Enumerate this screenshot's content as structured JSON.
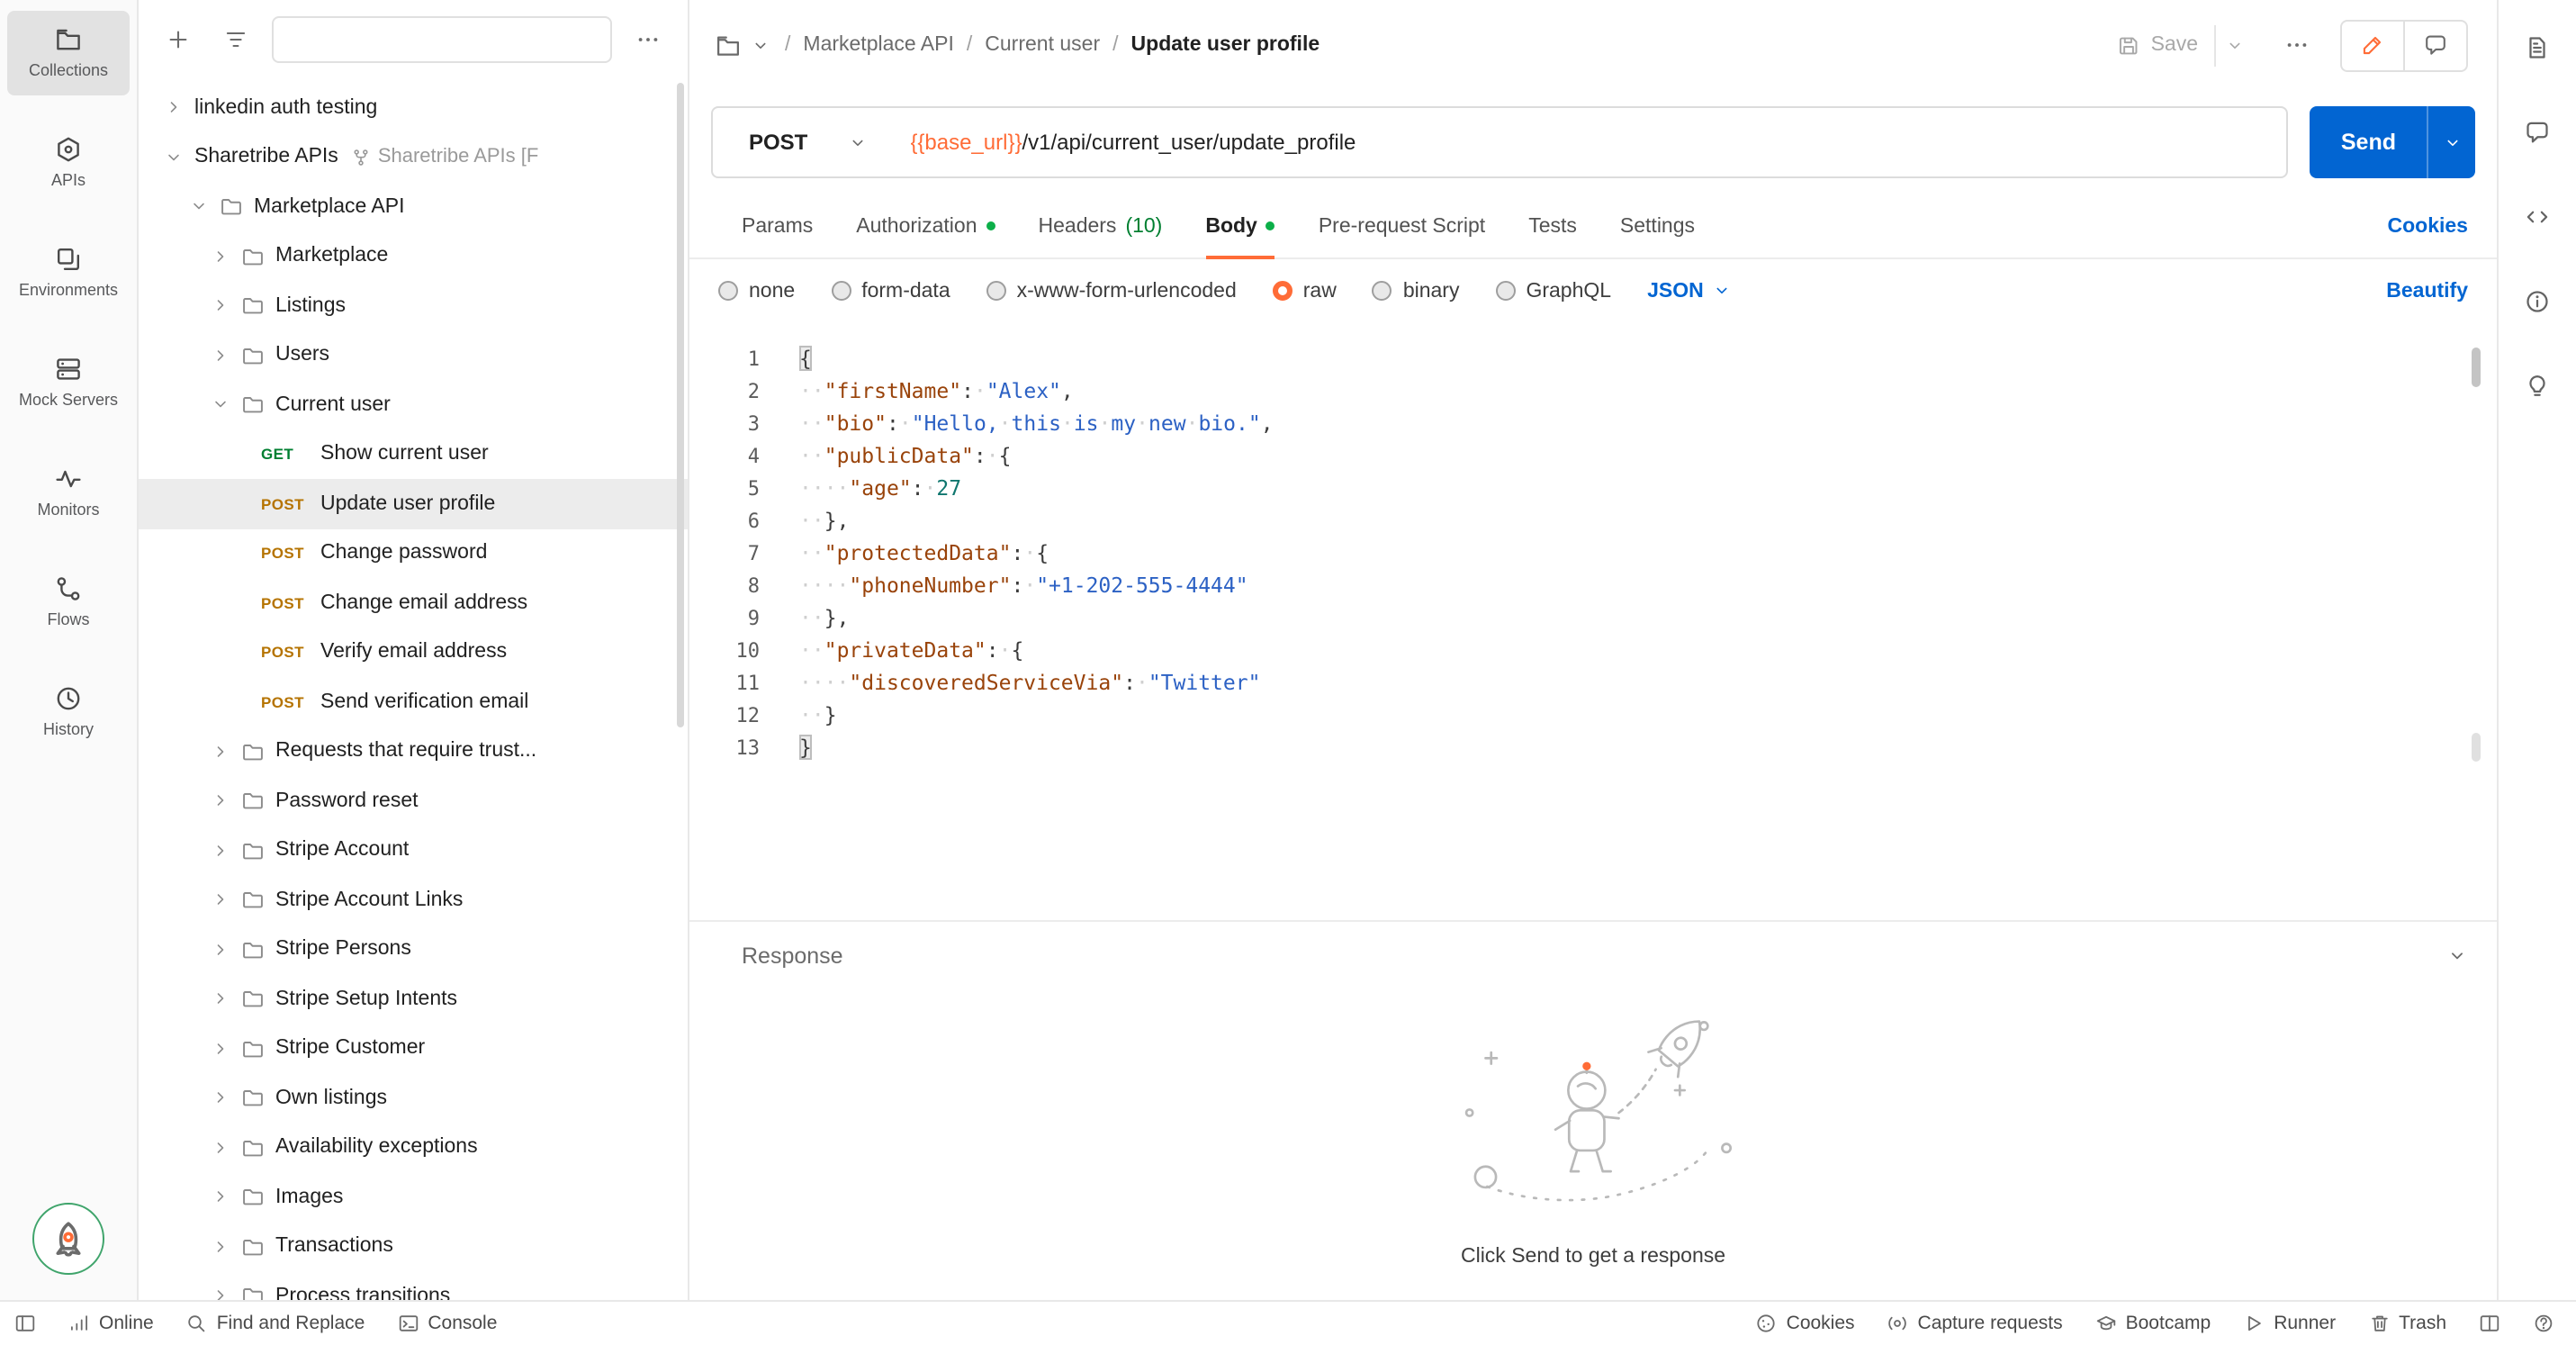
{
  "colors": {
    "accent": "#ff6c37",
    "primary_button": "#0265d2",
    "link": "#0265d2",
    "success_dot": "#0caf49",
    "method_get": "#007f31",
    "method_post": "#b57300"
  },
  "left_rail": {
    "items": [
      {
        "icon": "collections",
        "label": "Collections",
        "active": true
      },
      {
        "icon": "apis",
        "label": "APIs",
        "active": false
      },
      {
        "icon": "environments",
        "label": "Environments",
        "active": false
      },
      {
        "icon": "mock",
        "label": "Mock Servers",
        "active": false
      },
      {
        "icon": "monitors",
        "label": "Monitors",
        "active": false
      },
      {
        "icon": "flows",
        "label": "Flows",
        "active": false
      },
      {
        "icon": "history",
        "label": "History",
        "active": false
      }
    ]
  },
  "sidebar": {
    "search": {
      "value": "",
      "placeholder": ""
    },
    "tree": [
      {
        "kind": "collection",
        "chevron": "right",
        "label": "linkedin auth testing",
        "indent": 0
      },
      {
        "kind": "collection",
        "chevron": "down",
        "label": "Sharetribe APIs",
        "suffix": "Sharetribe APIs [F",
        "indent": 0
      },
      {
        "kind": "folder",
        "chevron": "down",
        "label": "Marketplace API",
        "indent": 1
      },
      {
        "kind": "folder",
        "chevron": "right",
        "label": "Marketplace",
        "indent": 2
      },
      {
        "kind": "folder",
        "chevron": "right",
        "label": "Listings",
        "indent": 2
      },
      {
        "kind": "folder",
        "chevron": "right",
        "label": "Users",
        "indent": 2
      },
      {
        "kind": "folder",
        "chevron": "down",
        "label": "Current user",
        "indent": 2
      },
      {
        "kind": "request",
        "method": "GET",
        "label": "Show current user",
        "indent": 3
      },
      {
        "kind": "request",
        "method": "POST",
        "label": "Update user profile",
        "indent": 3,
        "selected": true
      },
      {
        "kind": "request",
        "method": "POST",
        "label": "Change password",
        "indent": 3
      },
      {
        "kind": "request",
        "method": "POST",
        "label": "Change email address",
        "indent": 3
      },
      {
        "kind": "request",
        "method": "POST",
        "label": "Verify email address",
        "indent": 3
      },
      {
        "kind": "request",
        "method": "POST",
        "label": "Send verification email",
        "indent": 3
      },
      {
        "kind": "folder",
        "chevron": "right",
        "label": "Requests that require trust...",
        "indent": 2
      },
      {
        "kind": "folder",
        "chevron": "right",
        "label": "Password reset",
        "indent": 2
      },
      {
        "kind": "folder",
        "chevron": "right",
        "label": "Stripe Account",
        "indent": 2
      },
      {
        "kind": "folder",
        "chevron": "right",
        "label": "Stripe Account Links",
        "indent": 2
      },
      {
        "kind": "folder",
        "chevron": "right",
        "label": "Stripe Persons",
        "indent": 2
      },
      {
        "kind": "folder",
        "chevron": "right",
        "label": "Stripe Setup Intents",
        "indent": 2
      },
      {
        "kind": "folder",
        "chevron": "right",
        "label": "Stripe Customer",
        "indent": 2
      },
      {
        "kind": "folder",
        "chevron": "right",
        "label": "Own listings",
        "indent": 2
      },
      {
        "kind": "folder",
        "chevron": "right",
        "label": "Availability exceptions",
        "indent": 2
      },
      {
        "kind": "folder",
        "chevron": "right",
        "label": "Images",
        "indent": 2
      },
      {
        "kind": "folder",
        "chevron": "right",
        "label": "Transactions",
        "indent": 2
      },
      {
        "kind": "folder",
        "chevron": "right",
        "label": "Process transitions",
        "indent": 2
      }
    ]
  },
  "header": {
    "breadcrumb": [
      "Marketplace API",
      "Current user",
      "Update user profile"
    ],
    "save_label": "Save"
  },
  "request": {
    "method": "POST",
    "url_variable": "{{base_url}}",
    "url_path": "/v1/api/current_user/update_profile",
    "send_label": "Send"
  },
  "request_panel": {
    "tabs": [
      {
        "label": "Params"
      },
      {
        "label": "Authorization",
        "dot": true
      },
      {
        "label": "Headers",
        "count": "(10)"
      },
      {
        "label": "Body",
        "dot": true,
        "active": true
      },
      {
        "label": "Pre-request Script"
      },
      {
        "label": "Tests"
      },
      {
        "label": "Settings"
      }
    ],
    "cookies_label": "Cookies",
    "body_types": [
      {
        "label": "none"
      },
      {
        "label": "form-data"
      },
      {
        "label": "x-www-form-urlencoded"
      },
      {
        "label": "raw",
        "selected": true
      },
      {
        "label": "binary"
      },
      {
        "label": "GraphQL"
      }
    ],
    "language": "JSON",
    "beautify_label": "Beautify"
  },
  "editor": {
    "lines": [
      {
        "num": 1,
        "tokens": [
          {
            "t": "pun",
            "v": "{",
            "m": true
          }
        ]
      },
      {
        "num": 2,
        "tokens": [
          {
            "t": "ws",
            "n": 2
          },
          {
            "t": "key",
            "v": "\"firstName\""
          },
          {
            "t": "pun",
            "v": ":"
          },
          {
            "t": "ws",
            "n": 1
          },
          {
            "t": "str",
            "v": "\"Alex\""
          },
          {
            "t": "pun",
            "v": ","
          }
        ]
      },
      {
        "num": 3,
        "tokens": [
          {
            "t": "ws",
            "n": 2
          },
          {
            "t": "key",
            "v": "\"bio\""
          },
          {
            "t": "pun",
            "v": ":"
          },
          {
            "t": "ws",
            "n": 1
          },
          {
            "t": "str",
            "v": "\"Hello, this is my new bio.\""
          },
          {
            "t": "pun",
            "v": ","
          }
        ]
      },
      {
        "num": 4,
        "tokens": [
          {
            "t": "ws",
            "n": 2
          },
          {
            "t": "key",
            "v": "\"publicData\""
          },
          {
            "t": "pun",
            "v": ":"
          },
          {
            "t": "ws",
            "n": 1
          },
          {
            "t": "pun",
            "v": "{"
          }
        ]
      },
      {
        "num": 5,
        "tokens": [
          {
            "t": "ws",
            "n": 4
          },
          {
            "t": "key",
            "v": "\"age\""
          },
          {
            "t": "pun",
            "v": ":"
          },
          {
            "t": "ws",
            "n": 1
          },
          {
            "t": "num",
            "v": "27"
          }
        ]
      },
      {
        "num": 6,
        "tokens": [
          {
            "t": "ws",
            "n": 2
          },
          {
            "t": "pun",
            "v": "},"
          }
        ]
      },
      {
        "num": 7,
        "tokens": [
          {
            "t": "ws",
            "n": 2
          },
          {
            "t": "key",
            "v": "\"protectedData\""
          },
          {
            "t": "pun",
            "v": ":"
          },
          {
            "t": "ws",
            "n": 1
          },
          {
            "t": "pun",
            "v": "{"
          }
        ]
      },
      {
        "num": 8,
        "tokens": [
          {
            "t": "ws",
            "n": 4
          },
          {
            "t": "key",
            "v": "\"phoneNumber\""
          },
          {
            "t": "pun",
            "v": ":"
          },
          {
            "t": "ws",
            "n": 1
          },
          {
            "t": "str",
            "v": "\"+1-202-555-4444\""
          }
        ]
      },
      {
        "num": 9,
        "tokens": [
          {
            "t": "ws",
            "n": 2
          },
          {
            "t": "pun",
            "v": "},"
          }
        ]
      },
      {
        "num": 10,
        "tokens": [
          {
            "t": "ws",
            "n": 2
          },
          {
            "t": "key",
            "v": "\"privateData\""
          },
          {
            "t": "pun",
            "v": ":"
          },
          {
            "t": "ws",
            "n": 1
          },
          {
            "t": "pun",
            "v": "{"
          }
        ]
      },
      {
        "num": 11,
        "tokens": [
          {
            "t": "ws",
            "n": 4
          },
          {
            "t": "key",
            "v": "\"discoveredServiceVia\""
          },
          {
            "t": "pun",
            "v": ":"
          },
          {
            "t": "ws",
            "n": 1
          },
          {
            "t": "str",
            "v": "\"Twitter\""
          }
        ]
      },
      {
        "num": 12,
        "tokens": [
          {
            "t": "ws",
            "n": 2
          },
          {
            "t": "pun",
            "v": "}"
          }
        ]
      },
      {
        "num": 13,
        "tokens": [
          {
            "t": "pun",
            "v": "}",
            "m": true
          }
        ]
      }
    ]
  },
  "response": {
    "title": "Response",
    "empty_text": "Click Send to get a response"
  },
  "right_rail": {
    "items": [
      {
        "icon": "doc",
        "name": "documentation"
      },
      {
        "icon": "comment",
        "name": "comments"
      },
      {
        "icon": "code",
        "name": "code-snippet"
      },
      {
        "icon": "info",
        "name": "info"
      },
      {
        "icon": "bulb",
        "name": "tips"
      }
    ]
  },
  "status_bar": {
    "left": [
      {
        "icon": "panel",
        "name": "toggle-sidebar",
        "label": ""
      },
      {
        "icon": "signal",
        "name": "connection-status",
        "label": "Online"
      },
      {
        "icon": "search",
        "name": "find-and-replace",
        "label": "Find and Replace"
      },
      {
        "icon": "terminal",
        "name": "console",
        "label": "Console"
      }
    ],
    "right": [
      {
        "icon": "cookie",
        "name": "cookies",
        "label": "Cookies"
      },
      {
        "icon": "capture",
        "name": "capture-requests",
        "label": "Capture requests"
      },
      {
        "icon": "bootcamp",
        "name": "bootcamp",
        "label": "Bootcamp"
      },
      {
        "icon": "runner",
        "name": "runner",
        "label": "Runner"
      },
      {
        "icon": "trash",
        "name": "trash",
        "label": "Trash"
      },
      {
        "icon": "split",
        "name": "two-pane-view",
        "label": ""
      },
      {
        "icon": "help",
        "name": "help",
        "label": ""
      }
    ]
  }
}
